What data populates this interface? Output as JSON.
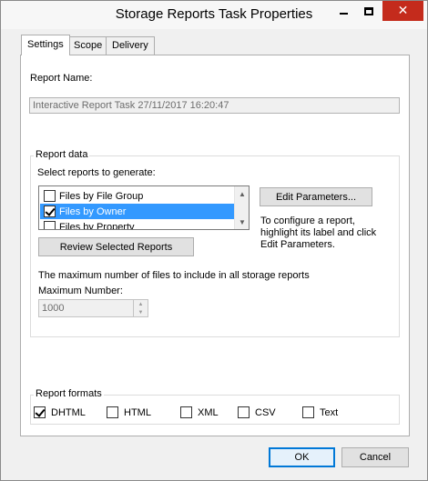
{
  "window": {
    "title": "Storage Reports Task Properties",
    "close_glyph": "✕"
  },
  "tabs": [
    {
      "label": "Settings",
      "active": true
    },
    {
      "label": "Scope",
      "active": false
    },
    {
      "label": "Delivery",
      "active": false
    }
  ],
  "report_name": {
    "label": "Report Name:",
    "value": "Interactive Report Task 27/11/2017 16:20:47"
  },
  "report_data": {
    "caption": "Report data",
    "select_label": "Select reports to generate:",
    "items": [
      {
        "label": "Files by File Group",
        "checked": false,
        "selected": false
      },
      {
        "label": "Files by Owner",
        "checked": true,
        "selected": true
      },
      {
        "label": "Files by Property",
        "checked": false,
        "selected": false
      }
    ],
    "edit_parameters_label": "Edit Parameters...",
    "help_text": "To configure a report, highlight its label and click Edit Parameters.",
    "review_label": "Review Selected Reports",
    "max_files_label": "The maximum number of files to include in all storage reports",
    "max_number_label": "Maximum Number:",
    "max_number_value": "1000"
  },
  "report_formats": {
    "caption": "Report formats",
    "items": [
      {
        "label": "DHTML",
        "checked": true
      },
      {
        "label": "HTML",
        "checked": false
      },
      {
        "label": "XML",
        "checked": false
      },
      {
        "label": "CSV",
        "checked": false
      },
      {
        "label": "Text",
        "checked": false
      }
    ]
  },
  "footer": {
    "ok_label": "OK",
    "cancel_label": "Cancel"
  },
  "colors": {
    "selection": "#3399ff",
    "close_button": "#c42b1c",
    "default_button_border": "#0078d7"
  }
}
